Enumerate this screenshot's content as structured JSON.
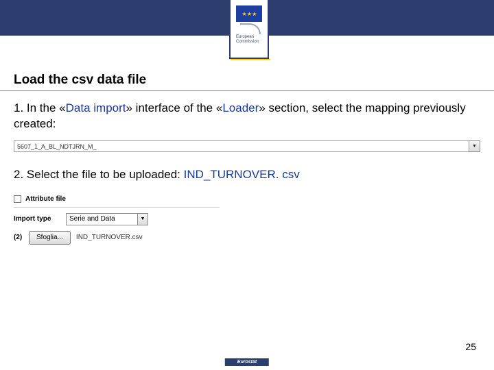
{
  "header": {
    "org_line1": "European",
    "org_line2": "Commission"
  },
  "title": "Load the csv data file",
  "steps": {
    "one": {
      "num": "1.",
      "text_before_quote1": " In the «",
      "quote1": "Data import",
      "mid": "» interface of the «",
      "quote2": "Loader",
      "after": "» section, select the mapping previously created:"
    },
    "two": {
      "num": "2.",
      "text": " Select the file to be uploaded: ",
      "file": "IND_TURNOVER. csv"
    }
  },
  "dropdown_value": "5607_1_A_BL_NDTJRN_M_",
  "import_panel": {
    "attribute_label": "Attribute file",
    "import_type_label": "Import type",
    "import_type_value": "Serie and Data",
    "row_label": "(2)",
    "browse_label": "Sfoglia...",
    "filename": "IND_TURNOVER.csv"
  },
  "page_number": "25",
  "footer": "Eurostat"
}
